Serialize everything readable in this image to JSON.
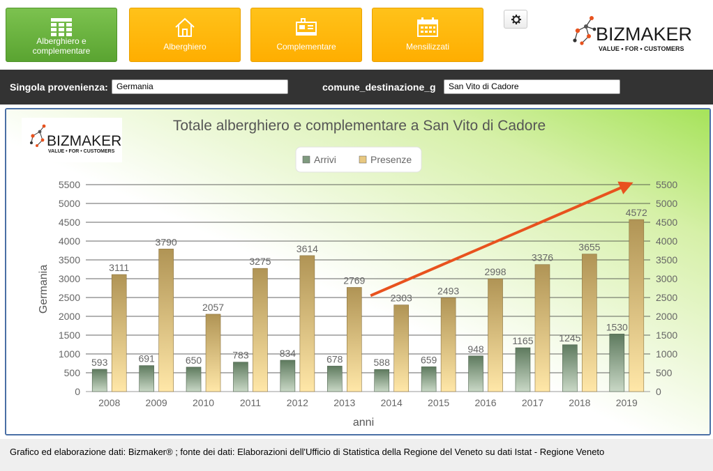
{
  "nav": [
    {
      "id": "alberghiero-e-complementare",
      "label_line1": "Alberghiero e",
      "label_line2": "complementare",
      "icon": "table-icon",
      "active": true
    },
    {
      "id": "alberghiero",
      "label_line1": "Alberghiero",
      "label_line2": "",
      "icon": "house-icon",
      "active": false
    },
    {
      "id": "complementare",
      "label_line1": "Complementare",
      "label_line2": "",
      "icon": "caravan-icon",
      "active": false
    },
    {
      "id": "mensilizzati",
      "label_line1": "Mensilizzati",
      "label_line2": "",
      "icon": "calendar-icon",
      "active": false
    }
  ],
  "settings_icon": "gear-icon",
  "brand": {
    "name": "BIZMAKER",
    "tagline": "VALUE • FOR • CUSTOMERS"
  },
  "filters": {
    "provenienza_label": "Singola provenienza:",
    "provenienza_value": "Germania",
    "destinazione_label": "comune_destinazione_g",
    "destinazione_value": "San Vito di Cadore"
  },
  "footer": {
    "text": "Grafico ed elaborazione dati: Bizmaker® ; fonte dei dati: Elaborazioni dell'Ufficio di Statistica della Regione del Veneto  su dati Istat - Regione Veneto"
  },
  "colors": {
    "green_button": "#66b23c",
    "orange_button": "#ffb300",
    "arrivi": "#7f9a7f",
    "presenze": "#d9b26a",
    "arrow": "#e8521e"
  },
  "chart_data": {
    "type": "bar",
    "title": "Totale alberghiero e complementare a San Vito di Cadore",
    "xlabel": "anni",
    "ylabel": "Germania",
    "ylim": [
      0,
      5500
    ],
    "ytick_step": 500,
    "grid": true,
    "legend_position": "top-center",
    "categories": [
      "2008",
      "2009",
      "2010",
      "2011",
      "2012",
      "2013",
      "2014",
      "2015",
      "2016",
      "2017",
      "2018",
      "2019"
    ],
    "series": [
      {
        "name": "Arrivi",
        "values": [
          593,
          691,
          650,
          783,
          834,
          678,
          588,
          659,
          948,
          1165,
          1245,
          1530
        ]
      },
      {
        "name": "Presenze",
        "values": [
          3111,
          3790,
          2057,
          3275,
          3614,
          2769,
          2303,
          2493,
          2998,
          3376,
          3655,
          4572
        ]
      }
    ],
    "annotation": {
      "type": "trend-arrow",
      "from": [
        "2014",
        2550
      ],
      "to": [
        "2019",
        5500
      ]
    }
  }
}
